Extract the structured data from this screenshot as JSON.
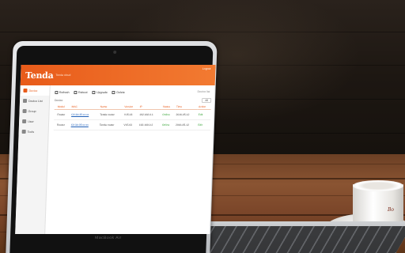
{
  "app": {
    "logo": "Tenda",
    "tagline": "Tenda cloud",
    "header_link": "Logout",
    "breadcrumb": "Device list"
  },
  "sidebar": {
    "items": [
      {
        "label": "Device",
        "icon": "device-icon",
        "active": true
      },
      {
        "label": "Device List",
        "icon": "list-icon",
        "active": false
      },
      {
        "label": "Group",
        "icon": "group-icon",
        "active": false
      },
      {
        "label": "User",
        "icon": "user-icon",
        "active": false
      },
      {
        "label": "Tools",
        "icon": "tools-icon",
        "active": false
      }
    ]
  },
  "toolbar": {
    "buttons": [
      {
        "label": "Refresh",
        "icon": "refresh-icon"
      },
      {
        "label": "Reboot",
        "icon": "reboot-icon"
      },
      {
        "label": "Upgrade",
        "icon": "upgrade-icon"
      },
      {
        "label": "Delete",
        "icon": "delete-icon"
      }
    ]
  },
  "filter": {
    "label": "Device",
    "select_value": "All"
  },
  "table": {
    "columns": [
      "",
      "Model",
      "MAC",
      "Name",
      "Version",
      "IP",
      "Status",
      "Time",
      "Action"
    ],
    "rows": [
      [
        "",
        "Router",
        "C8:3A:35:xx:xx",
        "Tenda router",
        "V15.03",
        "192.168.0.1",
        "Online",
        "2016-05-12",
        "Edit"
      ],
      [
        "",
        "Router",
        "C8:3A:35:xx:xx",
        "Tenda router",
        "V15.03",
        "192.168.0.2",
        "Online",
        "2016-05-12",
        "Edit"
      ]
    ]
  },
  "device_brand": "MacBook Air",
  "cup_print": "Bo"
}
